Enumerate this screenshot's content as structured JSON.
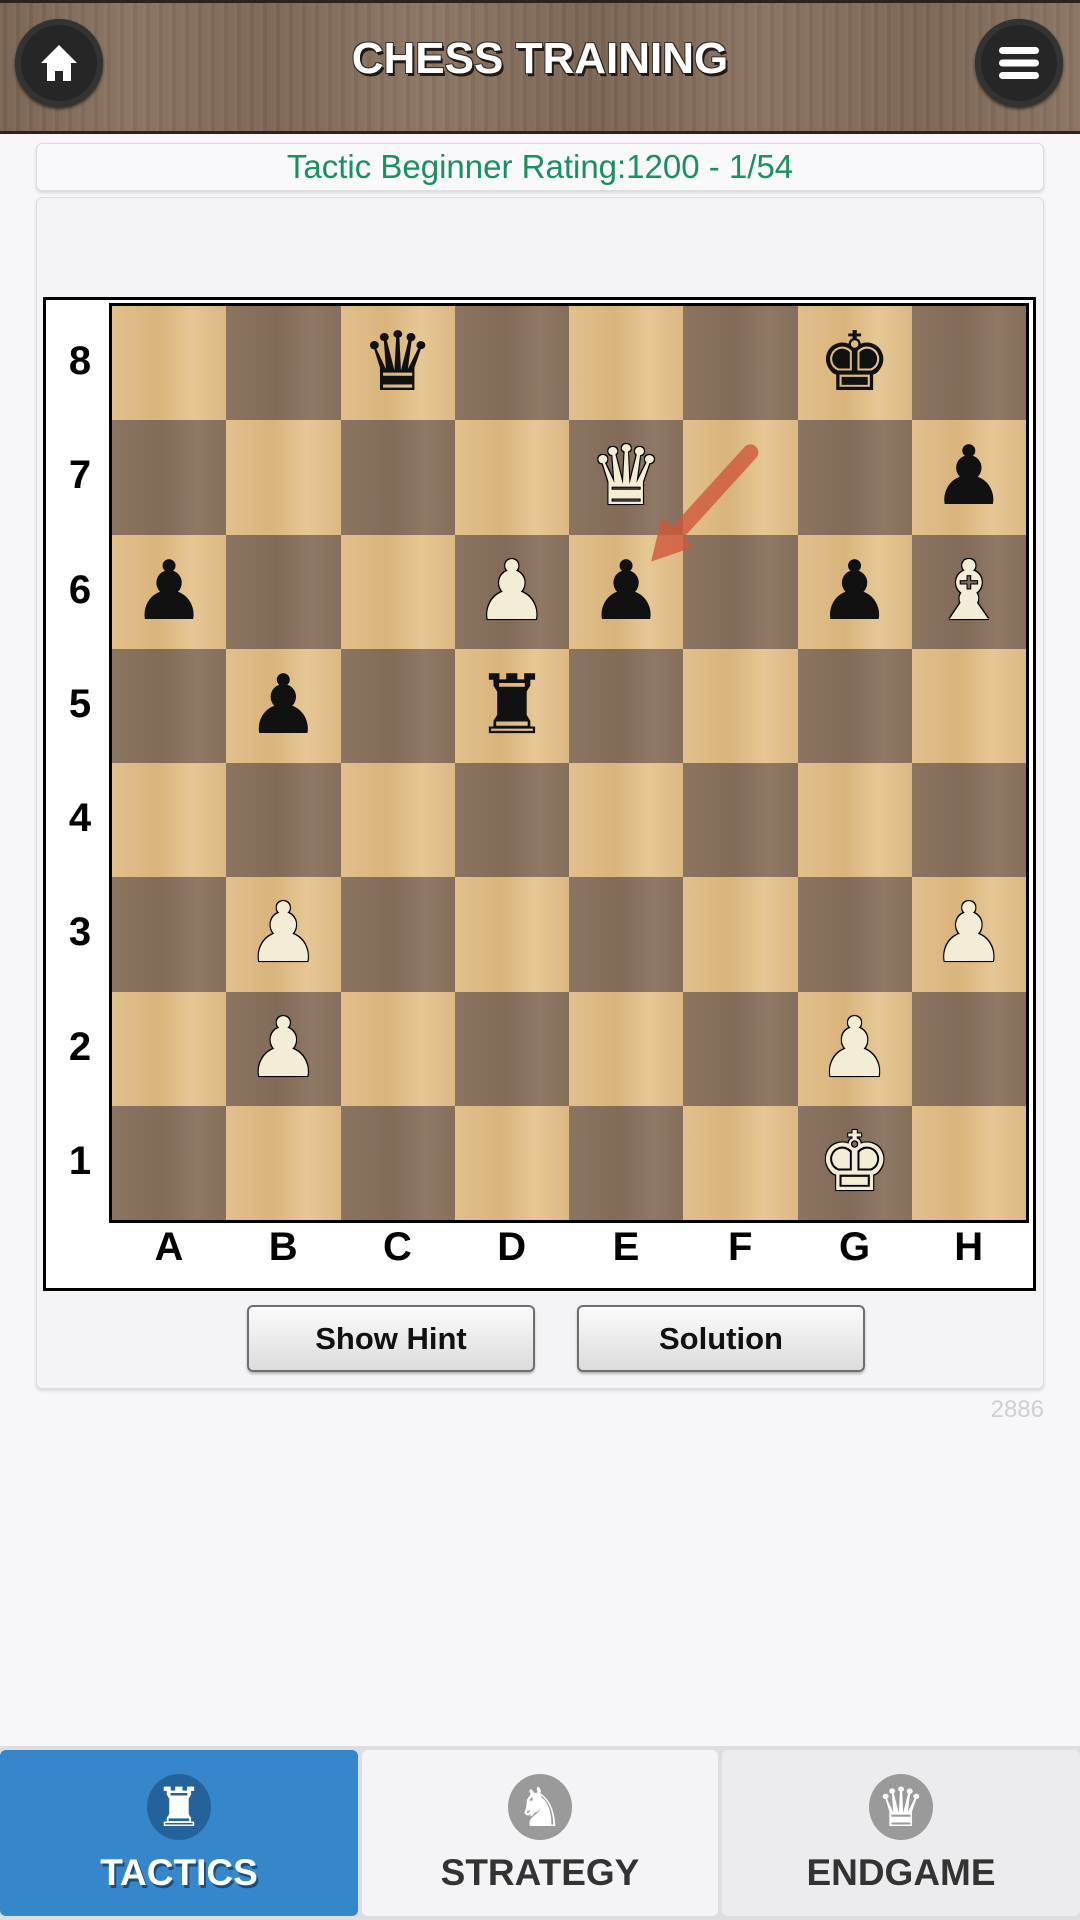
{
  "header": {
    "title": "CHESS TRAINING",
    "home_icon": "home-icon",
    "menu_icon": "hamburger-menu-icon"
  },
  "rating": {
    "text": "Tactic Beginner Rating:1200 - 1/54",
    "color": "#1a9060"
  },
  "board": {
    "ranks": [
      "8",
      "7",
      "6",
      "5",
      "4",
      "3",
      "2",
      "1"
    ],
    "files": [
      "A",
      "B",
      "C",
      "D",
      "E",
      "F",
      "G",
      "H"
    ],
    "pieces": [
      {
        "square": "c8",
        "color": "b",
        "type": "queen",
        "glyph": "♛"
      },
      {
        "square": "g8",
        "color": "b",
        "type": "king",
        "glyph": "♚"
      },
      {
        "square": "e7",
        "color": "w",
        "type": "queen",
        "glyph": "♛"
      },
      {
        "square": "h7",
        "color": "b",
        "type": "pawn",
        "glyph": "♟"
      },
      {
        "square": "a6",
        "color": "b",
        "type": "pawn",
        "glyph": "♟"
      },
      {
        "square": "d6",
        "color": "w",
        "type": "pawn",
        "glyph": "♟"
      },
      {
        "square": "e6",
        "color": "b",
        "type": "pawn",
        "glyph": "♟"
      },
      {
        "square": "g6",
        "color": "b",
        "type": "pawn",
        "glyph": "♟"
      },
      {
        "square": "h6",
        "color": "w",
        "type": "bishop",
        "glyph": "♝"
      },
      {
        "square": "b5",
        "color": "b",
        "type": "pawn",
        "glyph": "♟"
      },
      {
        "square": "d5",
        "color": "b",
        "type": "rook",
        "glyph": "♜"
      },
      {
        "square": "b3",
        "color": "w",
        "type": "pawn",
        "glyph": "♟"
      },
      {
        "square": "h3",
        "color": "w",
        "type": "pawn",
        "glyph": "♟"
      },
      {
        "square": "b2",
        "color": "w",
        "type": "pawn",
        "glyph": "♟"
      },
      {
        "square": "g2",
        "color": "w",
        "type": "pawn",
        "glyph": "♟"
      },
      {
        "square": "g1",
        "color": "w",
        "type": "king",
        "glyph": "♚"
      }
    ],
    "last_move_arrow": {
      "from": "f7",
      "to": "e6",
      "color": "#d0583a"
    }
  },
  "buttons": {
    "hint": "Show Hint",
    "solution": "Solution"
  },
  "counter": "2886",
  "bottom_nav": {
    "tabs": [
      {
        "label": "TACTICS",
        "icon": "rook-icon",
        "glyph": "♜",
        "active": true
      },
      {
        "label": "STRATEGY",
        "icon": "knight-icon",
        "glyph": "♞",
        "active": false
      },
      {
        "label": "ENDGAME",
        "icon": "queen-icon",
        "glyph": "♛",
        "active": false
      }
    ],
    "active_color": "#3686ca"
  }
}
